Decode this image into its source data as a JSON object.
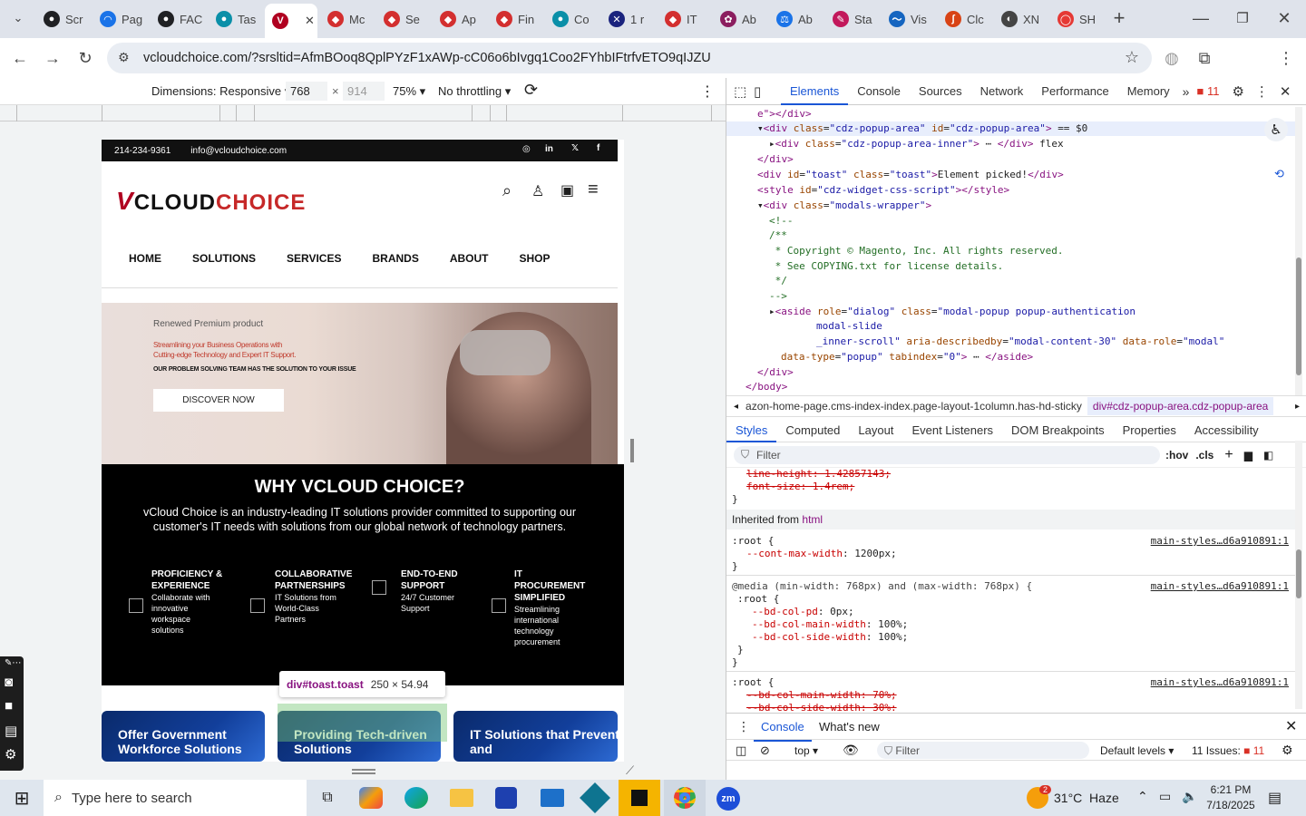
{
  "browser": {
    "tabs": [
      {
        "label": "Scr",
        "color": "#202124",
        "glyph": "●"
      },
      {
        "label": "Pag",
        "color": "#1a73e8",
        "glyph": "◠"
      },
      {
        "label": "FAC",
        "color": "#202124",
        "glyph": "●"
      },
      {
        "label": "Tas",
        "color": "#0a8fa8",
        "glyph": "●"
      },
      {
        "label": "",
        "color": "#b00020",
        "glyph": "V",
        "active": true
      },
      {
        "label": "Mc",
        "color": "#d32f2f",
        "glyph": "◆"
      },
      {
        "label": "Se",
        "color": "#d32f2f",
        "glyph": "◆"
      },
      {
        "label": "Ap",
        "color": "#d32f2f",
        "glyph": "◆"
      },
      {
        "label": "Fin",
        "color": "#d32f2f",
        "glyph": "◆"
      },
      {
        "label": "Co",
        "color": "#0a8fa8",
        "glyph": "●"
      },
      {
        "label": "1 r",
        "color": "#1a237e",
        "glyph": "✕"
      },
      {
        "label": "IT",
        "color": "#d32f2f",
        "glyph": "◆"
      },
      {
        "label": "Ab",
        "color": "#8b1e5f",
        "glyph": "✿"
      },
      {
        "label": "Ab",
        "color": "#1a73e8",
        "glyph": "⚖"
      },
      {
        "label": "Sta",
        "color": "#c2185b",
        "glyph": "✎"
      },
      {
        "label": "Vis",
        "color": "#1565c0",
        "glyph": "〜"
      },
      {
        "label": "Clc",
        "color": "#d84315",
        "glyph": "ʃ"
      },
      {
        "label": "XN",
        "color": "#444",
        "glyph": "◐"
      },
      {
        "label": "SH",
        "color": "#e53935",
        "glyph": "◯"
      }
    ],
    "url": "vcloudchoice.com/?srsltid=AfmBOoq8QplPYzF1xAWp-cC06o6bIvgq1Coo2FYhbIFtrfvETO9qIJZU",
    "profile_initial": "t"
  },
  "device_toolbar": {
    "dimensions_label": "Dimensions: Responsive",
    "width": "768",
    "times": "×",
    "height": "914",
    "zoom": "75%",
    "throttling": "No throttling"
  },
  "site": {
    "phone": "214-234-9361",
    "email": "info@vcloudchoice.com",
    "logo_v": "V",
    "logo_cloud": "CLOUD",
    "logo_choice": "CHOICE",
    "nav": [
      "HOME",
      "SOLUTIONS",
      "SERVICES",
      "BRANDS",
      "ABOUT",
      "SHOP"
    ],
    "hero": {
      "kicker": "Renewed Premium product",
      "line1": "Streamlining your Business Operations with",
      "line2": "Cutting-edge Technology and Expert IT Support.",
      "line3": "OUR PROBLEM SOLVING TEAM HAS THE SOLUTION TO YOUR ISSUE",
      "cta": "DISCOVER NOW"
    },
    "why": {
      "title": "WHY VCLOUD CHOICE?",
      "body1": "vCloud Choice is an industry-leading IT solutions provider committed to supporting our",
      "body2": "customer's IT needs with solutions from our global network of technology partners.",
      "features": [
        {
          "h1": "PROFICIENCY &",
          "h2": "EXPERIENCE",
          "d": [
            "Collaborate with",
            "innovative",
            "workspace",
            "solutions"
          ]
        },
        {
          "h1": "COLLABORATIVE",
          "h2": "PARTNERSHIPS",
          "d": [
            "IT Solutions from",
            "World-Class",
            "Partners"
          ]
        },
        {
          "h1": "END-TO-END",
          "h2": "SUPPORT",
          "d": [
            "24/7 Customer",
            "Support"
          ]
        },
        {
          "h1": "IT",
          "h2": "PROCUREMENT",
          "h3": "SIMPLIFIED",
          "d": [
            "Streamlining",
            "international",
            "technology",
            "procurement"
          ]
        }
      ]
    },
    "cards": [
      {
        "l1": "Offer Government",
        "l2": "Workforce Solutions"
      },
      {
        "l1": "Providing Tech-driven",
        "l2": "Solutions"
      },
      {
        "l1": "IT Solutions that Prevent",
        "l2": "and"
      }
    ],
    "tooltip": {
      "selector": "div#toast.toast",
      "size": "250 × 54.94"
    }
  },
  "devtools": {
    "tabs": [
      "Elements",
      "Console",
      "Sources",
      "Network",
      "Performance",
      "Memory"
    ],
    "issues_count": "11",
    "dom_lines": [
      {
        "i": 2,
        "html": "<span class='tg'>e\"&gt;&lt;/div&gt;</span>"
      },
      {
        "i": 2,
        "sel": true,
        "html": "<span class='tx'>▾</span><span class='tg'>&lt;div</span> <span class='at'>class</span>=<span class='av'>\"cdz-popup-area\"</span> <span class='at'>id</span>=<span class='av'>\"cdz-popup-area\"</span><span class='tg'>&gt;</span> <span class='tx'>== $0</span>"
      },
      {
        "i": 3,
        "html": "<span class='tx'>▸</span><span class='tg'>&lt;div</span> <span class='at'>class</span>=<span class='av'>\"cdz-popup-area-inner\"</span><span class='tg'>&gt;</span> <span class='tx'>⋯</span> <span class='tg'>&lt;/div&gt;</span> <span class='tx'>flex</span>"
      },
      {
        "i": 2,
        "html": "<span class='tg'>&lt;/div&gt;</span>"
      },
      {
        "i": 2,
        "html": "<span class='tg'>&lt;div</span> <span class='at'>id</span>=<span class='av'>\"toast\"</span> <span class='at'>class</span>=<span class='av'>\"toast\"</span><span class='tg'>&gt;</span><span class='tx'>Element picked!</span><span class='tg'>&lt;/div&gt;</span>"
      },
      {
        "i": 2,
        "html": "<span class='tg'>&lt;style</span> <span class='at'>id</span>=<span class='av'>\"cdz-widget-css-script\"</span><span class='tg'>&gt;&lt;/style&gt;</span>"
      },
      {
        "i": 2,
        "html": "<span class='tx'>▾</span><span class='tg'>&lt;div</span> <span class='at'>class</span>=<span class='av'>\"modals-wrapper\"</span><span class='tg'>&gt;</span>"
      },
      {
        "i": 3,
        "html": "<span class='cm'>&lt;!--</span>"
      },
      {
        "i": 3,
        "html": "<span class='cm'>/**</span>"
      },
      {
        "i": 3,
        "html": "<span class='cm'> * Copyright © Magento, Inc. All rights reserved.</span>"
      },
      {
        "i": 3,
        "html": "<span class='cm'> * See COPYING.txt for license details.</span>"
      },
      {
        "i": 3,
        "html": "<span class='cm'> */</span>"
      },
      {
        "i": 3,
        "html": "<span class='cm'>--&gt;</span>"
      },
      {
        "i": 3,
        "html": "<span class='tx'>▸</span><span class='tg'>&lt;aside</span> <span class='at'>role</span>=<span class='av'>\"dialog\"</span> <span class='at'>class</span>=<span class='av'>\"modal-popup popup-authentication</span>"
      },
      {
        "i": 7,
        "html": "<span class='av'>modal-slide</span>"
      },
      {
        "i": 7,
        "html": "<span class='av'>_inner-scroll\"</span> <span class='at'>aria-describedby</span>=<span class='av'>\"modal-content-30\"</span> <span class='at'>data-role</span>=<span class='av'>\"modal\"</span>"
      },
      {
        "i": 4,
        "html": "<span class='at'>data-type</span>=<span class='av'>\"popup\"</span> <span class='at'>tabindex</span>=<span class='av'>\"0\"</span><span class='tg'>&gt;</span> <span class='tx'>⋯</span> <span class='tg'>&lt;/aside&gt;</span>"
      },
      {
        "i": 2,
        "html": "<span class='tg'>&lt;/div&gt;</span>"
      },
      {
        "i": 1,
        "html": "<span class='tg'>&lt;/body&gt;</span>"
      }
    ],
    "breadcrumb_left": "azon-home-page.cms-index-index.page-layout-1column.has-hd-sticky",
    "breadcrumb_right": "div#cdz-popup-area.cdz-popup-area",
    "subtabs": [
      "Styles",
      "Computed",
      "Layout",
      "Event Listeners",
      "DOM Breakpoints",
      "Properties",
      "Accessibility"
    ],
    "filter_placeholder": "Filter",
    "hov": ":hov",
    "cls": ".cls",
    "styles": {
      "struck1": "line-height: 1.42857143;",
      "struck2": "font-size: 1.4rem;",
      "inherited_label": "Inherited from",
      "inherited_tag": "html",
      "root_sel": ":root {",
      "root_prop": "--cont-max-width",
      "root_val": "1200px;",
      "src": "main-styles…d6a910891:1",
      "media": "@media (min-width: 768px) and (max-width: 768px) {",
      "m_props": [
        {
          "p": "--bd-col-pd",
          "v": "0px;"
        },
        {
          "p": "--bd-col-main-width",
          "v": "100%;"
        },
        {
          "p": "--bd-col-side-width",
          "v": "100%;"
        }
      ],
      "last_struck1": "--bd-col-main-width: 70%;",
      "last_struck2": "--bd-col-side-width: 30%;"
    },
    "drawer": {
      "tabs": [
        "Console",
        "What's new"
      ],
      "context": "top",
      "filter": "Filter",
      "levels": "Default levels",
      "issues": "11 Issues:",
      "issues_n": "11"
    }
  },
  "taskbar": {
    "search_placeholder": "Type here to search",
    "weather": "31°C  Haze",
    "weather_badge": "2",
    "time": "6:21 PM",
    "date": "7/18/2025"
  }
}
